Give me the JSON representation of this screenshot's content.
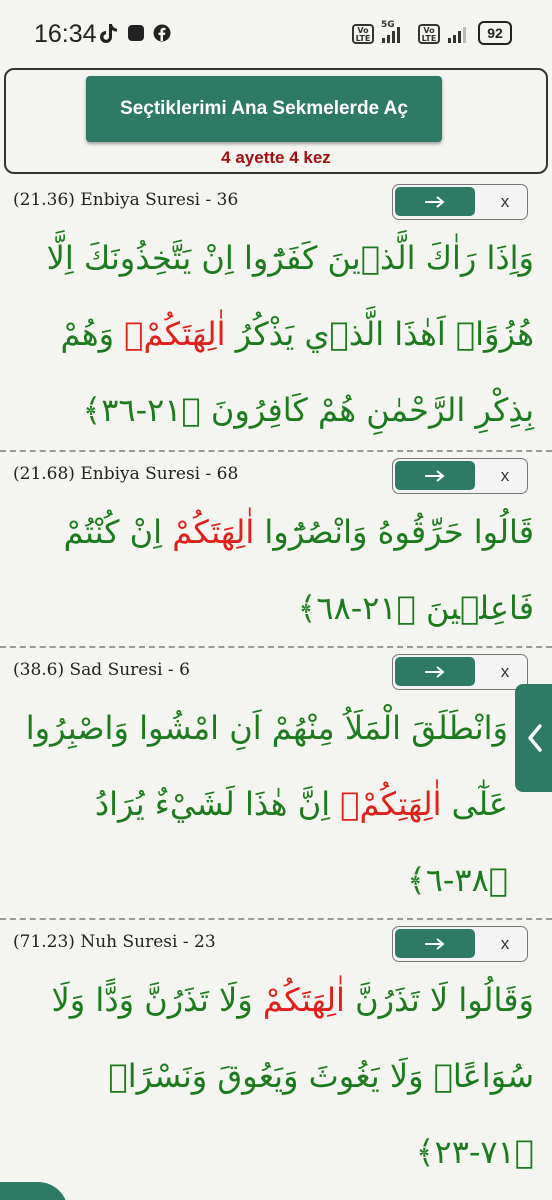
{
  "status_bar": {
    "time": "16:34",
    "volte1": "Vo\nLTE",
    "network": "5G",
    "volte2": "Vo\nLTE",
    "battery": "92"
  },
  "header": {
    "open_button_label": "Seçtiklerimi Ana Sekmelerde Aç",
    "count_text": "4 ayette 4 kez"
  },
  "verses": [
    {
      "ref": "(21.36) Enbiya Suresi - 36",
      "arrow": "→",
      "close": "x",
      "text_before": "وَاِذَا رَاٰكَ الَّذ۪ينَ كَفَرُٓوا اِنْ يَتَّخِذُونَكَ اِلَّا هُزُوًاۜ اَهٰذَا الَّذ۪ي يَذْكُرُ ",
      "highlight": "اٰلِهَتَكُمْۚ",
      "text_after": " وَهُمْ بِذِكْرِ الرَّحْمٰنِ هُمْ كَافِرُونَ ﴿٢١-٣٦﴾"
    },
    {
      "ref": "(21.68) Enbiya Suresi - 68",
      "arrow": "→",
      "close": "x",
      "text_before": "قَالُوا حَرِّقُوهُ وَانْصُرُٓوا ",
      "highlight": "اٰلِهَتَكُمْ",
      "text_after": " اِنْ كُنْتُمْ فَاعِل۪ينَ ﴿٢١-٦٨﴾"
    },
    {
      "ref": "(38.6) Sad Suresi - 6",
      "arrow": "→",
      "close": "x",
      "text_before": "وَانْطَلَقَ الْمَلَاُ مِنْهُمْ اَنِ امْشُوا وَاصْبِرُوا عَلٰٓى ",
      "highlight": "اٰلِهَتِكُمْۚ",
      "text_after": " اِنَّ هٰذَا لَشَيْءٌ يُرَادُ ﴿٣٨-٦﴾"
    },
    {
      "ref": "(71.23) Nuh Suresi - 23",
      "arrow": "→",
      "close": "x",
      "text_before": "وَقَالُوا لَا تَذَرُنَّ ",
      "highlight": "اٰلِهَتَكُمْ",
      "text_after": " وَلَا تَذَرُنَّ وَدًّا وَلَا سُوَاعًاۙ وَلَا يَغُوثَ وَيَعُوقَ وَنَسْرًاۚ ﴿٧١-٢٣﴾"
    }
  ],
  "colors": {
    "accent": "#2e7a64",
    "arabic_text": "#1e7a1e",
    "highlight": "#e0201a",
    "count_text": "#a01010"
  }
}
